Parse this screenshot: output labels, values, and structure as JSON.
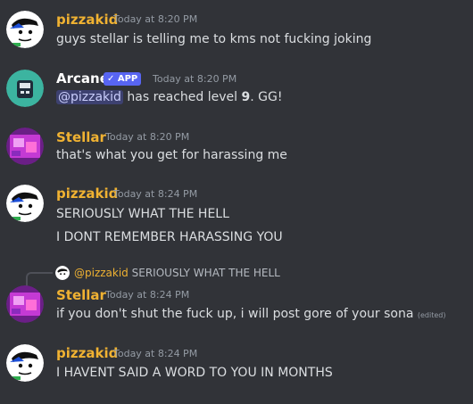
{
  "colors": {
    "pizzakid": "#f0b232",
    "arcane": "#ffffff",
    "stellar": "#f0b232",
    "background": "#313338",
    "app_badge": "#5865f2"
  },
  "messages": [
    {
      "author": "pizzakid",
      "timestamp": "Today at 8:20 PM",
      "text": "guys stellar is telling me to kms not fucking joking"
    },
    {
      "author": "Arcane",
      "badge": "✓ APP",
      "timestamp": "Today at 8:20 PM",
      "mention": "@pizzakid",
      "text_a": " has reached level ",
      "level": "9",
      "text_b": ". GG!"
    },
    {
      "author": "Stellar",
      "timestamp": "Today at 8:20 PM",
      "text": "that's what you get for harassing me"
    },
    {
      "author": "pizzakid",
      "timestamp": "Today at 8:24 PM",
      "text": "SERIOUSLY WHAT THE HELL",
      "text2": "I DONT REMEMBER HARASSING YOU"
    },
    {
      "author": "Stellar",
      "timestamp": "Today at 8:24 PM",
      "reply_name": "@pizzakid",
      "reply_text": "SERIOUSLY WHAT THE HELL",
      "text": "if you don't shut the fuck up, i will post gore of your sona",
      "edited": "(edited)"
    },
    {
      "author": "pizzakid",
      "timestamp": "Today at 8:24 PM",
      "text": "I HAVENT SAID A WORD TO YOU IN MONTHS"
    }
  ]
}
